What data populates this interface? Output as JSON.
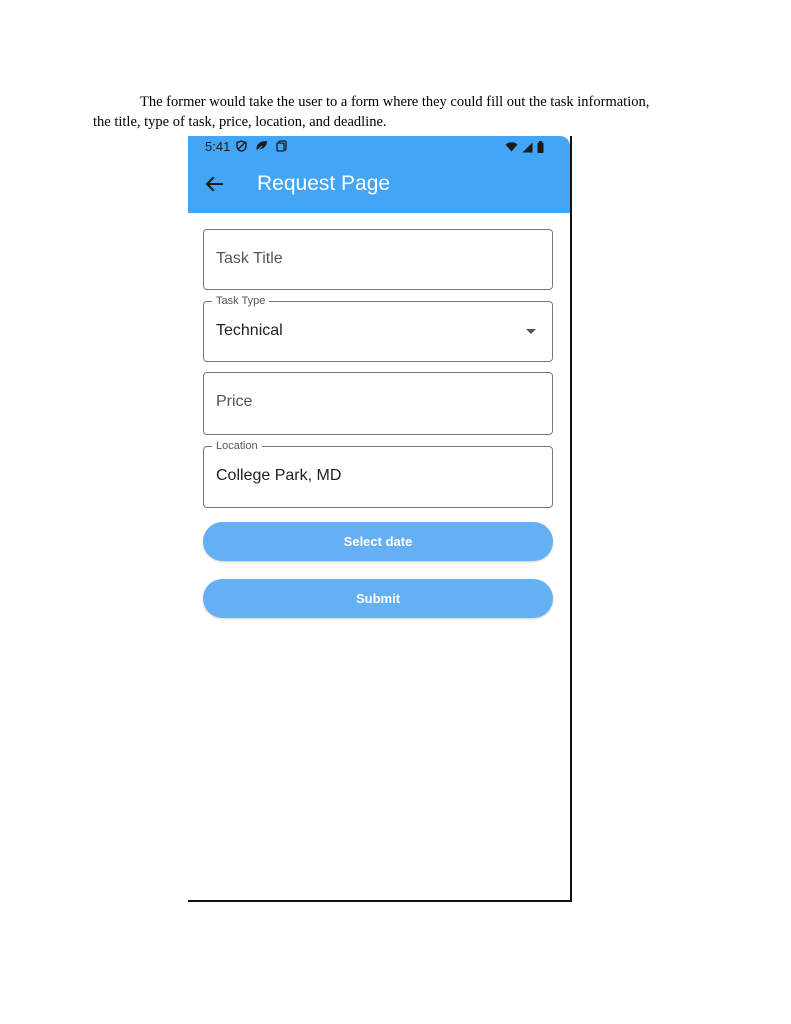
{
  "document": {
    "line1": "The former would take the user to a form where they could fill out the task information,",
    "line2": "the title, type of task, price, location, and deadline."
  },
  "status_bar": {
    "time": "5:41",
    "icons_left": [
      "vpn-shield-icon",
      "leaf-icon",
      "copy-icon"
    ],
    "icons_right": [
      "wifi-icon",
      "signal-icon",
      "battery-icon"
    ],
    "color": "#42a5f5"
  },
  "app_bar": {
    "title": "Request Page",
    "back_icon": "arrow-left-icon",
    "color": "#42a5f5"
  },
  "form": {
    "task_title": {
      "placeholder": "Task Title",
      "value": ""
    },
    "task_type": {
      "label": "Task Type",
      "value": "Technical"
    },
    "price": {
      "placeholder": "Price",
      "value": ""
    },
    "location": {
      "label": "Location",
      "value": "College Park, MD"
    },
    "select_date_label": "Select date",
    "submit_label": "Submit",
    "button_color": "#64b0f2"
  }
}
